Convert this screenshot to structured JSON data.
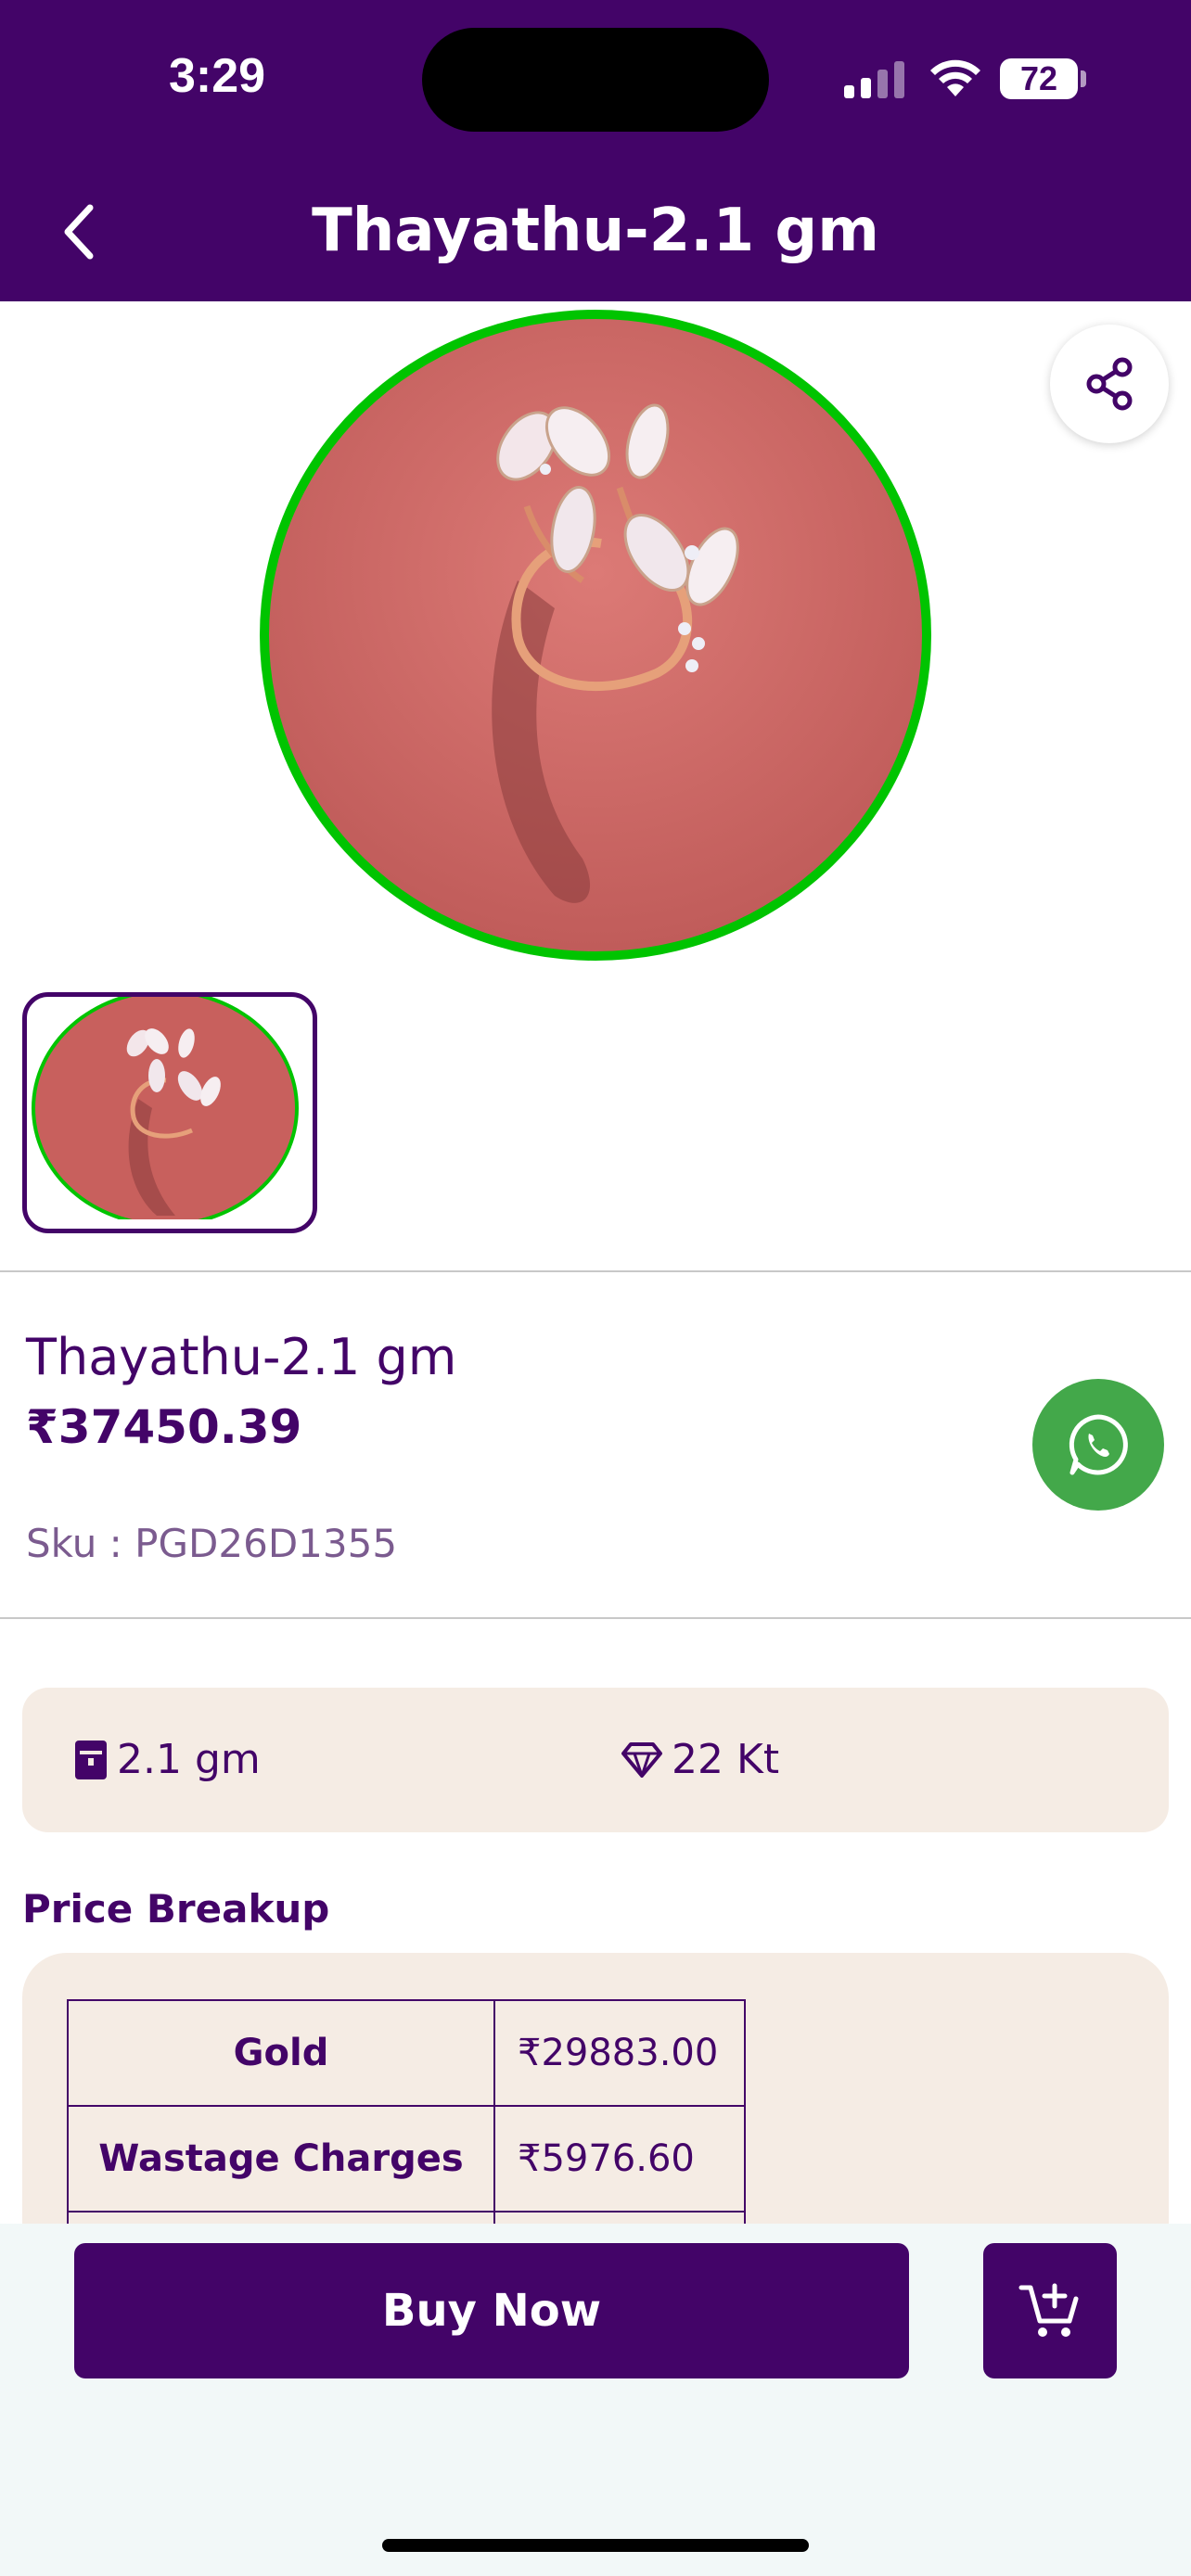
{
  "status_bar": {
    "time": "3:29",
    "battery": "72"
  },
  "header": {
    "title": "Thayathu-2.1 gm"
  },
  "product": {
    "name": "Thayathu-2.1 gm",
    "price": "₹37450.39",
    "sku": "Sku : PGD26D1355"
  },
  "specs": {
    "weight": "2.1 gm",
    "purity": "22 Kt"
  },
  "price_breakup": {
    "title": "Price Breakup",
    "rows": [
      {
        "label": "Gold",
        "value": "₹29883.00"
      },
      {
        "label": "Wastage Charges",
        "value": "₹5976.60"
      }
    ]
  },
  "actions": {
    "buy_now": "Buy Now"
  },
  "colors": {
    "brand": "#430468",
    "image_ring": "#00c400",
    "whatsapp": "#43a84a",
    "card_bg": "#f5ece4"
  }
}
